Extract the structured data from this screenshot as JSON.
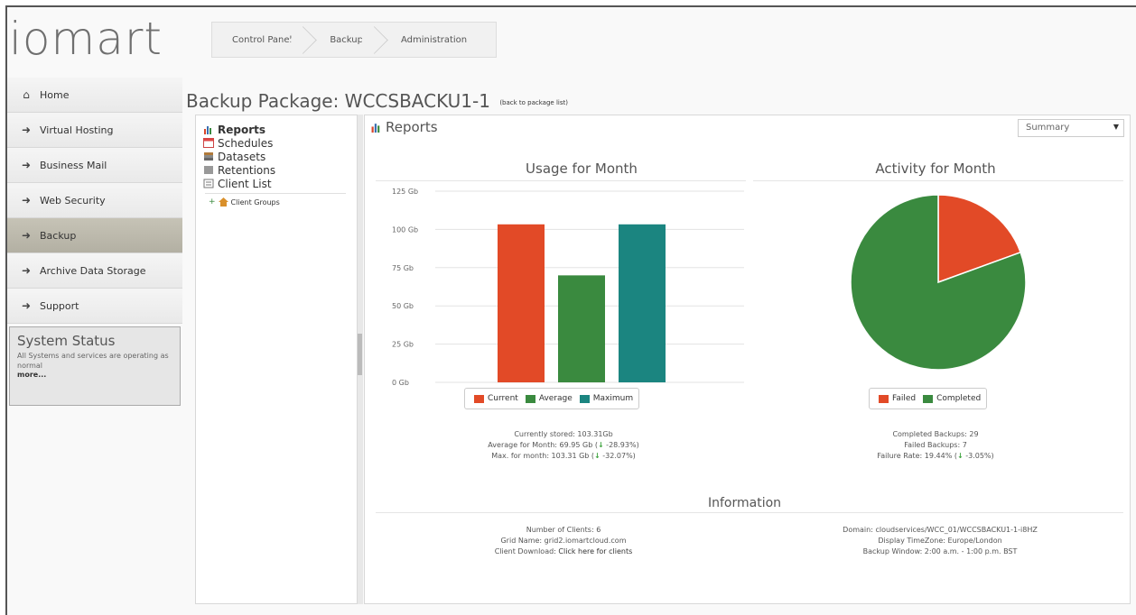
{
  "brand": {
    "logo": "iomart"
  },
  "breadcrumb": [
    "Control Panel",
    "Backup",
    "Administration"
  ],
  "sidebar": {
    "items": [
      {
        "label": "Home",
        "icon": "home-icon"
      },
      {
        "label": "Virtual Hosting",
        "icon": "arrow-right-icon"
      },
      {
        "label": "Business Mail",
        "icon": "arrow-right-icon"
      },
      {
        "label": "Web Security",
        "icon": "arrow-right-icon"
      },
      {
        "label": "Backup",
        "icon": "arrow-right-icon",
        "active": true
      },
      {
        "label": "Archive Data Storage",
        "icon": "arrow-right-icon"
      },
      {
        "label": "Support",
        "icon": "arrow-right-icon"
      }
    ],
    "status": {
      "title": "System Status",
      "text": "All Systems and services are operating as normal",
      "more": "more..."
    }
  },
  "page": {
    "title": "Backup Package: WCCSBACKU1-1",
    "back_link": "(back to package list)"
  },
  "tree": {
    "items": [
      "Reports",
      "Schedules",
      "Datasets",
      "Retentions",
      "Client List"
    ],
    "sub": "Client Groups"
  },
  "main": {
    "title": "Reports",
    "view_select": "Summary"
  },
  "usage": {
    "title": "Usage for Month",
    "legend": [
      "Current",
      "Average",
      "Maximum"
    ],
    "stats": {
      "stored": "Currently stored: 103.31Gb",
      "average": "Average for Month: 69.95 Gb (",
      "average_delta": " -28.93%)",
      "max": "Max. for month: 103.31 Gb (",
      "max_delta": " -32.07%)"
    }
  },
  "activity": {
    "title": "Activity for Month",
    "legend": [
      "Failed",
      "Completed"
    ],
    "stats": {
      "completed": "Completed Backups: 29",
      "failed": "Failed Backups: 7",
      "rate": "Failure Rate: 19.44% (",
      "rate_delta": " -3.05%)"
    }
  },
  "information": {
    "title": "Information",
    "left": {
      "clients": "Number of Clients: 6",
      "grid": "Grid Name: grid2.iomartcloud.com",
      "download_label": "Client Download: ",
      "download_link": "Click here for clients"
    },
    "right": {
      "domain": "Domain: cloudservices/WCC_01/WCCSBACKU1-1-i8HZ",
      "timezone": "Display TimeZone: Europe/London",
      "window": "Backup Window: 2:00 a.m. - 1:00 p.m. BST"
    }
  },
  "chart_data": [
    {
      "type": "bar",
      "title": "Usage for Month",
      "categories": [
        "Current",
        "Average",
        "Maximum"
      ],
      "values": [
        103.31,
        69.95,
        103.31
      ],
      "colors": [
        "#e24a27",
        "#3a8a3f",
        "#1b8580"
      ],
      "yticks": [
        "0 Gb",
        "25 Gb",
        "50 Gb",
        "75 Gb",
        "100 Gb",
        "125 Gb"
      ],
      "ylim": [
        0,
        125
      ],
      "grid": true,
      "legend": "bottom"
    },
    {
      "type": "pie",
      "title": "Activity for Month",
      "labels": [
        "Failed",
        "Completed"
      ],
      "values": [
        7,
        29
      ],
      "colors": [
        "#e24a27",
        "#3a8a3f"
      ],
      "legend": "bottom"
    }
  ]
}
